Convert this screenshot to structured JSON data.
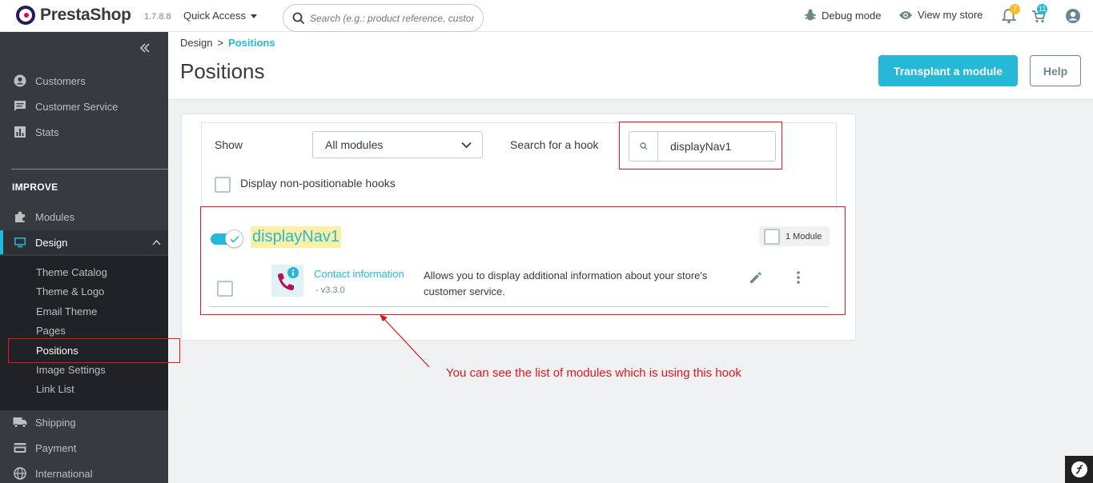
{
  "topbar": {
    "brand": "PrestaShop",
    "version": "1.7.8.8",
    "quick_access": "Quick Access",
    "search_placeholder": "Search (e.g.: product reference, custon",
    "debug_mode": "Debug mode",
    "view_store": "View my store",
    "notifications_count": "7",
    "orders_count": "11",
    "colors": {
      "accent": "#25b9d7",
      "badge_orange": "#fbbb22"
    }
  },
  "sidebar": {
    "top_items": [
      {
        "label": "Customers",
        "icon": "account-circle-icon"
      },
      {
        "label": "Customer Service",
        "icon": "chat-icon"
      },
      {
        "label": "Stats",
        "icon": "bar-chart-icon"
      }
    ],
    "section_title": "IMPROVE",
    "modules": "Modules",
    "design": "Design",
    "design_sub": [
      "Theme Catalog",
      "Theme & Logo",
      "Email Theme",
      "Pages",
      "Positions",
      "Image Settings",
      "Link List"
    ],
    "bottom_items": [
      {
        "label": "Shipping",
        "icon": "truck-icon"
      },
      {
        "label": "Payment",
        "icon": "credit-card-icon"
      },
      {
        "label": "International",
        "icon": "globe-icon"
      }
    ]
  },
  "header": {
    "breadcrumb_parent": "Design",
    "breadcrumb_sep": ">",
    "breadcrumb_current": "Positions",
    "title": "Positions",
    "transplant_button": "Transplant a module",
    "help_button": "Help"
  },
  "filters": {
    "show_label": "Show",
    "show_value": "All modules",
    "search_label": "Search for a hook",
    "search_value": "displayNav1",
    "non_positionable_label": "Display non-positionable hooks"
  },
  "hook": {
    "name": "displayNav1",
    "module_count": "1 Module",
    "modules": [
      {
        "name": "Contact information",
        "version": "- v3.3.0",
        "description": "Allows you to display additional information about your store's customer service."
      }
    ]
  },
  "annotation": "You can see the list of modules which is using this hook"
}
